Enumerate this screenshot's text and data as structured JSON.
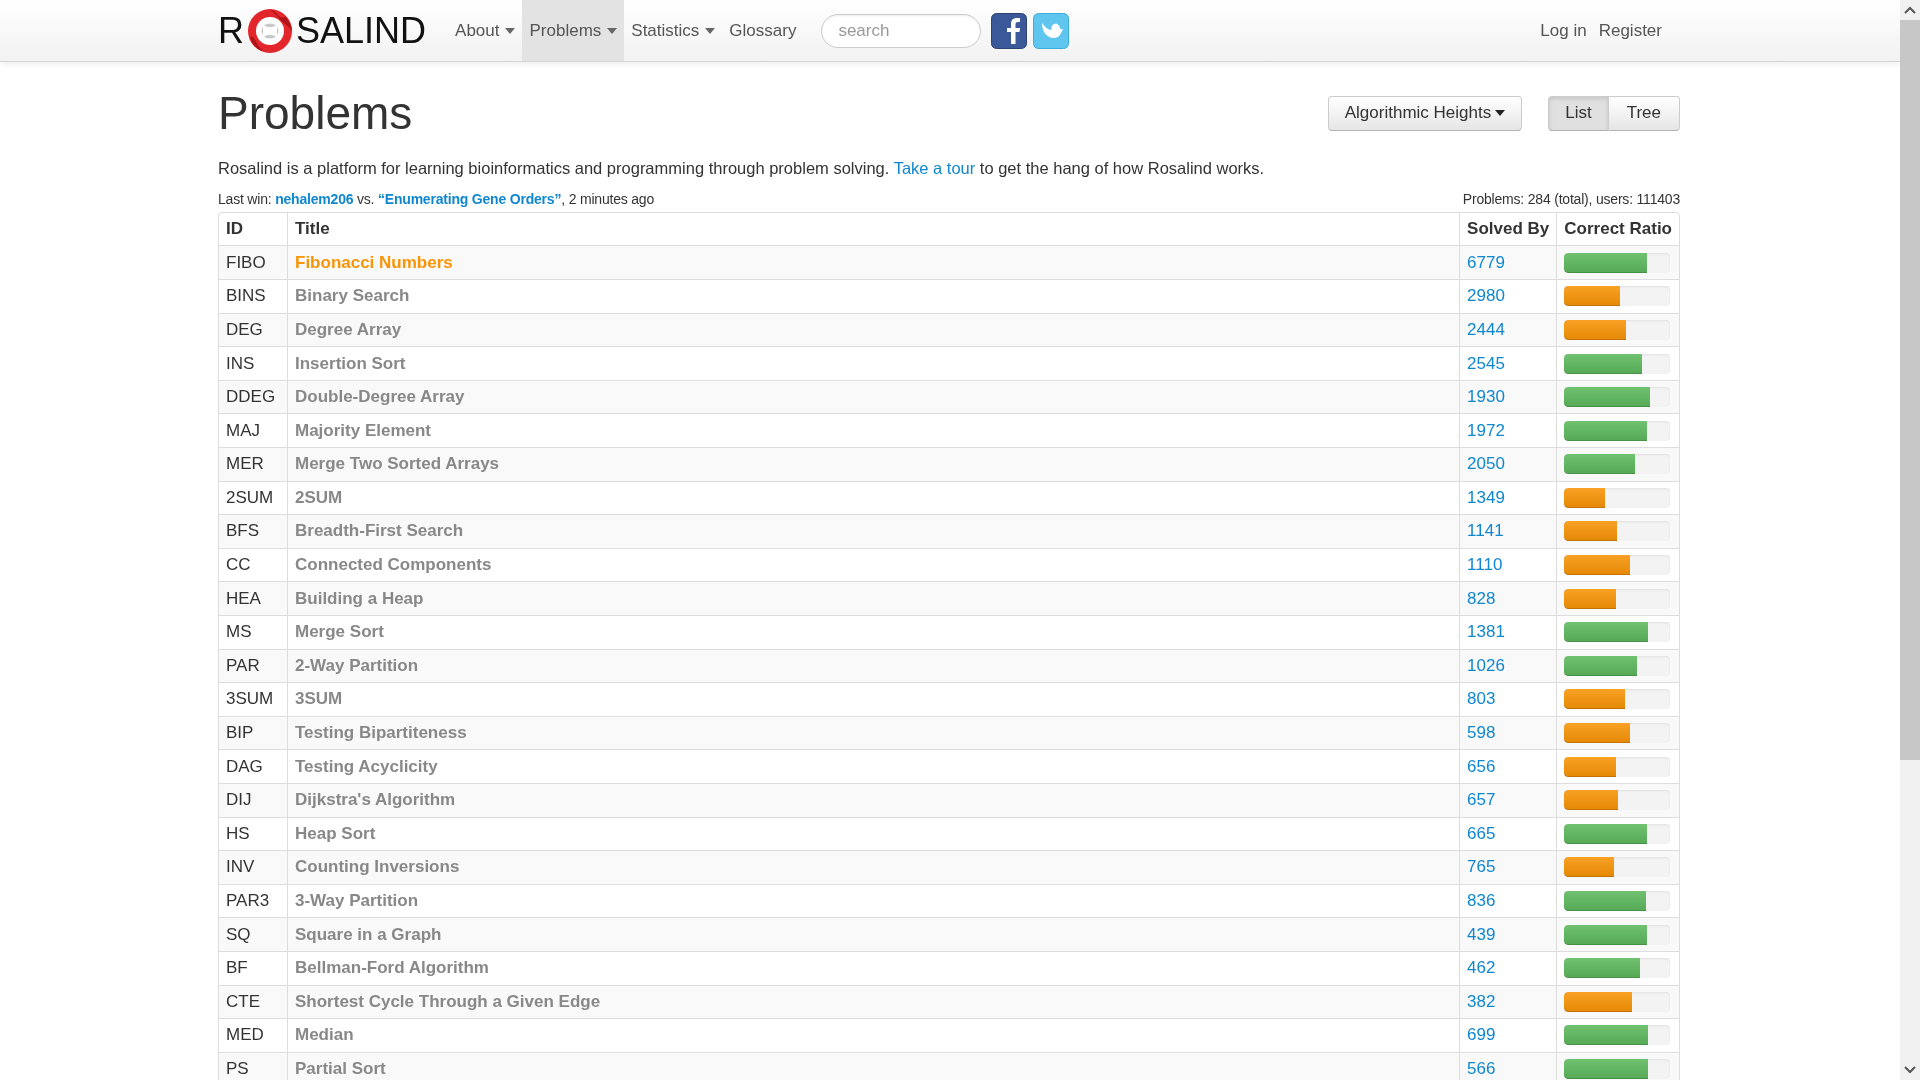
{
  "navbar": {
    "logo": {
      "left": "R",
      "right": "SALIND"
    },
    "menu": [
      {
        "label": "About",
        "dropdown": true,
        "selected": false
      },
      {
        "label": "Problems",
        "dropdown": true,
        "selected": true
      },
      {
        "label": "Statistics",
        "dropdown": true,
        "selected": false
      },
      {
        "label": "Glossary",
        "dropdown": false,
        "selected": false
      }
    ],
    "search": {
      "placeholder": "search"
    },
    "account": [
      "Log in",
      "Register"
    ]
  },
  "header": {
    "title": "Problems",
    "topic": "Algorithmic Heights",
    "views": [
      {
        "label": "List",
        "selected": true
      },
      {
        "label": "Tree",
        "selected": false
      }
    ]
  },
  "intro": {
    "before": "Rosalind is a platform for learning bioinformatics and programming through problem solving. ",
    "link": "Take a tour",
    "after": " to get the hang of how Rosalind works."
  },
  "last_win": {
    "label": "Last win: ",
    "user": "nehalem206",
    "vs": " vs. ",
    "problem": "“Enumerating Gene Orders”",
    "time": ", 2 minutes ago"
  },
  "stats": "Problems: 284 (total), users: 111403",
  "table": {
    "columns": [
      "ID",
      "Title",
      "Solved By",
      "Correct Ratio"
    ],
    "rows": [
      {
        "id": "FIBO",
        "title": "Fibonacci Numbers",
        "current": true,
        "solved_by": "6779",
        "level": 0.78,
        "color": "#5cb85c"
      },
      {
        "id": "BINS",
        "title": "Binary Search",
        "current": false,
        "solved_by": "2980",
        "level": 0.53,
        "color": "#f89406"
      },
      {
        "id": "DEG",
        "title": "Degree Array",
        "current": false,
        "solved_by": "2444",
        "level": 0.58,
        "color": "#f89406"
      },
      {
        "id": "INS",
        "title": "Insertion Sort",
        "current": false,
        "solved_by": "2545",
        "level": 0.73,
        "color": "#5cb85c"
      },
      {
        "id": "DDEG",
        "title": "Double-Degree Array",
        "current": false,
        "solved_by": "1930",
        "level": 0.81,
        "color": "#5cb85c"
      },
      {
        "id": "MAJ",
        "title": "Majority Element",
        "current": false,
        "solved_by": "1972",
        "level": 0.78,
        "color": "#5cb85c"
      },
      {
        "id": "MER",
        "title": "Merge Two Sorted Arrays",
        "current": false,
        "solved_by": "2050",
        "level": 0.67,
        "color": "#5cb85c"
      },
      {
        "id": "2SUM",
        "title": "2SUM",
        "current": false,
        "solved_by": "1349",
        "level": 0.38,
        "color": "#f89406"
      },
      {
        "id": "BFS",
        "title": "Breadth-First Search",
        "current": false,
        "solved_by": "1141",
        "level": 0.5,
        "color": "#f89406"
      },
      {
        "id": "CC",
        "title": "Connected Components",
        "current": false,
        "solved_by": "1110",
        "level": 0.62,
        "color": "#f89406"
      },
      {
        "id": "HEA",
        "title": "Building a Heap",
        "current": false,
        "solved_by": "828",
        "level": 0.49,
        "color": "#f89406"
      },
      {
        "id": "MS",
        "title": "Merge Sort",
        "current": false,
        "solved_by": "1381",
        "level": 0.79,
        "color": "#5cb85c"
      },
      {
        "id": "PAR",
        "title": "2-Way Partition",
        "current": false,
        "solved_by": "1026",
        "level": 0.69,
        "color": "#5cb85c"
      },
      {
        "id": "3SUM",
        "title": "3SUM",
        "current": false,
        "solved_by": "803",
        "level": 0.57,
        "color": "#f89406"
      },
      {
        "id": "BIP",
        "title": "Testing Bipartiteness",
        "current": false,
        "solved_by": "598",
        "level": 0.62,
        "color": "#f89406"
      },
      {
        "id": "DAG",
        "title": "Testing Acyclicity",
        "current": false,
        "solved_by": "656",
        "level": 0.49,
        "color": "#f89406"
      },
      {
        "id": "DIJ",
        "title": "Dijkstra's Algorithm",
        "current": false,
        "solved_by": "657",
        "level": 0.51,
        "color": "#f89406"
      },
      {
        "id": "HS",
        "title": "Heap Sort",
        "current": false,
        "solved_by": "665",
        "level": 0.78,
        "color": "#5cb85c"
      },
      {
        "id": "INV",
        "title": "Counting Inversions",
        "current": false,
        "solved_by": "765",
        "level": 0.47,
        "color": "#f89406"
      },
      {
        "id": "PAR3",
        "title": "3-Way Partition",
        "current": false,
        "solved_by": "836",
        "level": 0.77,
        "color": "#5cb85c"
      },
      {
        "id": "SQ",
        "title": "Square in a Graph",
        "current": false,
        "solved_by": "439",
        "level": 0.78,
        "color": "#5cb85c"
      },
      {
        "id": "BF",
        "title": "Bellman-Ford Algorithm",
        "current": false,
        "solved_by": "462",
        "level": 0.71,
        "color": "#5cb85c"
      },
      {
        "id": "CTE",
        "title": "Shortest Cycle Through a Given Edge",
        "current": false,
        "solved_by": "382",
        "level": 0.64,
        "color": "#f89406"
      },
      {
        "id": "MED",
        "title": "Median",
        "current": false,
        "solved_by": "699",
        "level": 0.79,
        "color": "#5cb85c"
      },
      {
        "id": "PS",
        "title": "Partial Sort",
        "current": false,
        "solved_by": "566",
        "level": 0.79,
        "color": "#5cb85c"
      }
    ]
  }
}
